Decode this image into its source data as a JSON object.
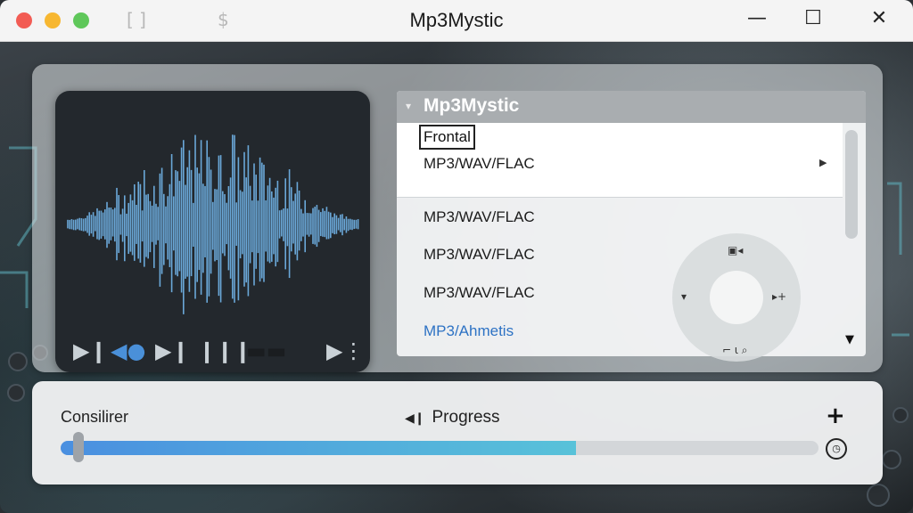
{
  "window": {
    "title": "Mp3Mystic"
  },
  "titlebar": {
    "icons": [
      "bracket-icon",
      "dollar-icon"
    ],
    "bracket_glyph": "[ ]",
    "dollar_glyph": "$",
    "minimize": "—",
    "maximize": "☐",
    "close": "✕"
  },
  "player": {
    "controls": [
      {
        "name": "play-next-icon",
        "glyph": "▶❙"
      },
      {
        "name": "volume-icon",
        "glyph": "◀●"
      },
      {
        "name": "skip-icon",
        "glyph": "▶❙"
      },
      {
        "name": "level-icon",
        "glyph": "❙❙❙"
      },
      {
        "name": "seek-pill-icon",
        "glyph": "▬▬"
      },
      {
        "name": "queue-icon",
        "glyph": "▶⋮"
      }
    ]
  },
  "list": {
    "header": "Mp3Mystic",
    "selected": "Frontal",
    "items": [
      "MP3/WAV/FLAC",
      "MP3/WAV/FLAC",
      "MP3/WAV/FLAC",
      "MP3/WAV/FLAC"
    ],
    "link_item": "MP3/Ahmetis"
  },
  "wheel": {
    "top": "▣◂",
    "left": "▾",
    "right": "▸+",
    "bottom": "⌐ ι ⌕"
  },
  "progress": {
    "left_label": "Consilirer",
    "center_label": "Progress",
    "center_icon": "◀❙",
    "plus": "+",
    "timer": "◷",
    "value_percent": 68
  },
  "colors": {
    "accent": "#4a90d9",
    "wave": "#6aa8d8",
    "link": "#2d72c4"
  }
}
